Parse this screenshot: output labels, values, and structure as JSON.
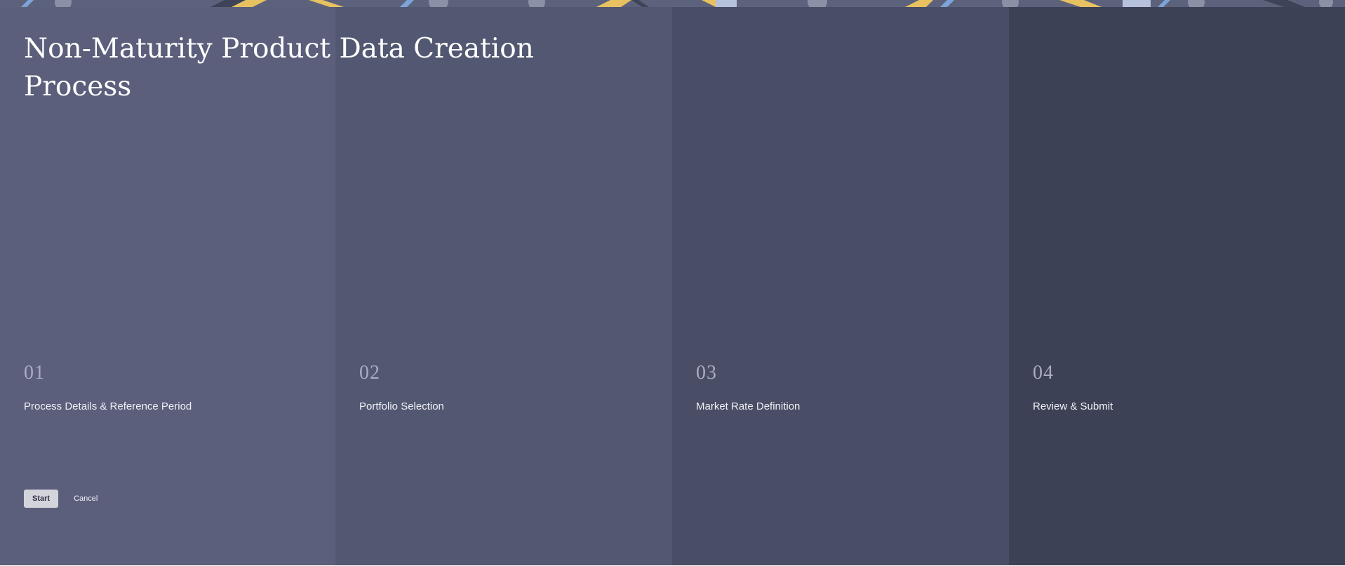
{
  "page": {
    "title": "Non-Maturity Product Data Creation Process"
  },
  "steps": [
    {
      "number": "01",
      "label": "Process Details & Reference Period"
    },
    {
      "number": "02",
      "label": "Portfolio Selection"
    },
    {
      "number": "03",
      "label": "Market Rate Definition"
    },
    {
      "number": "04",
      "label": "Review & Submit"
    }
  ],
  "actions": {
    "start_label": "Start",
    "cancel_label": "Cancel"
  },
  "colors": {
    "panel_1": "#5b5f7b",
    "panel_2": "#535872",
    "panel_3": "#494d65",
    "panel_4": "#3d4155",
    "banner_accent": "#e8c160",
    "banner_blue": "#7da3d8"
  }
}
